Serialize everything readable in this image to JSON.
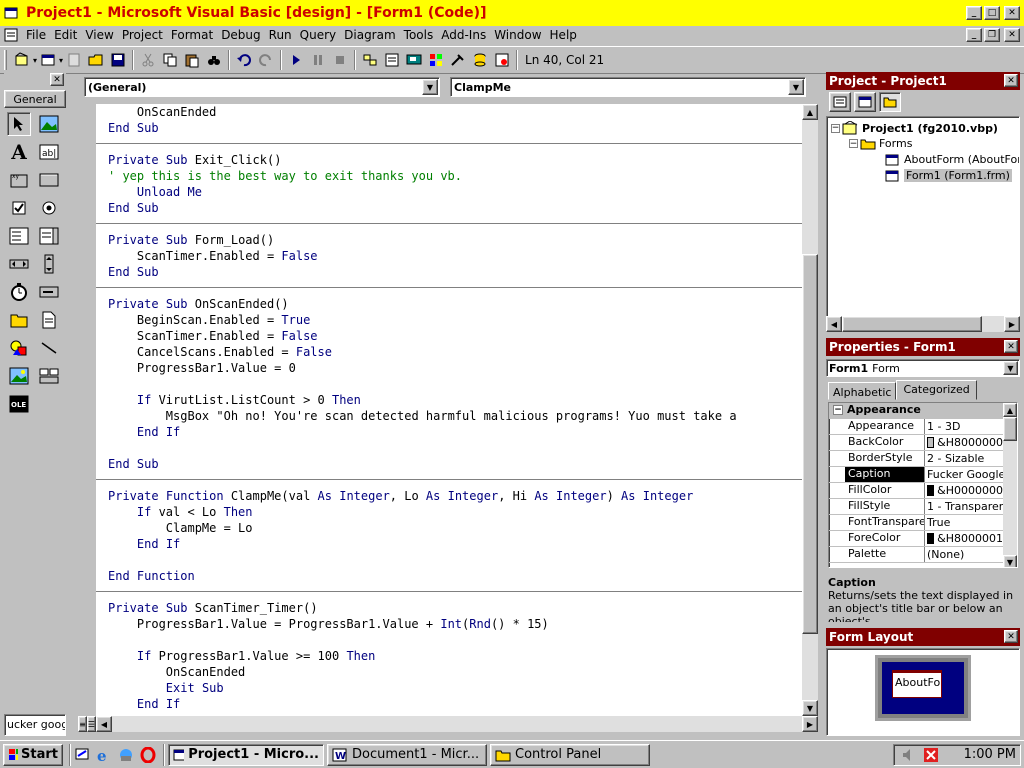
{
  "window": {
    "title": "Project1 - Microsoft Visual Basic [design] - [Form1 (Code)]"
  },
  "menu": [
    "File",
    "Edit",
    "View",
    "Project",
    "Format",
    "Debug",
    "Run",
    "Query",
    "Diagram",
    "Tools",
    "Add-Ins",
    "Window",
    "Help"
  ],
  "toolbar": {
    "position": "Ln 40, Col 21"
  },
  "toolbox": {
    "tab_label": "General",
    "status": "ucker googl"
  },
  "code": {
    "object_combo": "(General)",
    "procedure_combo": "ClampMe",
    "blocks": [
      [
        {
          "t": "    OnScanEnded"
        },
        {
          "t": "End Sub",
          "k": 1
        }
      ],
      [
        {
          "t": "Private Sub Exit_Click()",
          "k": 1
        },
        {
          "t": "' yep this is the best way to exit thanks you vb.",
          "c": 1
        },
        {
          "t": "    Unload Me"
        },
        {
          "t": "End Sub",
          "k": 1
        }
      ],
      [
        {
          "t": "Private Sub Form_Load()",
          "k": 1
        },
        {
          "t": "    ScanTimer.Enabled = False"
        },
        {
          "t": "End Sub",
          "k": 1
        }
      ],
      [
        {
          "t": "Private Sub OnScanEnded()",
          "k": 1
        },
        {
          "t": "    BeginScan.Enabled = True"
        },
        {
          "t": "    ScanTimer.Enabled = False"
        },
        {
          "t": "    CancelScans.Enabled = False"
        },
        {
          "t": "    ProgressBar1.Value = 0"
        },
        {
          "t": ""
        },
        {
          "t": "    If VirutList.ListCount > 0 Then"
        },
        {
          "t": "        MsgBox \"Oh no! You're scan detected harmful malicious programs! Yuo must take a"
        },
        {
          "t": "    End If"
        },
        {
          "t": ""
        },
        {
          "t": "End Sub",
          "k": 1
        }
      ],
      [
        {
          "t": "Private Function ClampMe(val As Integer, Lo As Integer, Hi As Integer) As Integer",
          "k": 1
        },
        {
          "t": "    If val < Lo Then"
        },
        {
          "t": "        ClampMe = Lo"
        },
        {
          "t": "    End If"
        },
        {
          "t": ""
        },
        {
          "t": "End Function",
          "k": 1
        }
      ],
      [
        {
          "t": "Private Sub ScanTimer_Timer()",
          "k": 1
        },
        {
          "t": "    ProgressBar1.Value = ProgressBar1.Value + Int(Rnd() * 15)"
        },
        {
          "t": ""
        },
        {
          "t": "    If ProgressBar1.Value >= 100 Then"
        },
        {
          "t": "        OnScanEnded"
        },
        {
          "t": "        Exit Sub"
        },
        {
          "t": "    End If"
        }
      ]
    ]
  },
  "project": {
    "title": "Project - Project1",
    "root": "Project1 (fg2010.vbp)",
    "folder": "Forms",
    "items": [
      "AboutForm (AboutForm",
      "Form1 (Form1.frm)"
    ]
  },
  "properties": {
    "title": "Properties - Form1",
    "object_name": "Form1",
    "object_type": "Form",
    "tabs": [
      "Alphabetic",
      "Categorized"
    ],
    "category": "Appearance",
    "rows": [
      {
        "name": "Appearance",
        "value": "1 - 3D"
      },
      {
        "name": "BackColor",
        "value": "&H8000000",
        "swatch": "#c0c0c0"
      },
      {
        "name": "BorderStyle",
        "value": "2 - Sizable"
      },
      {
        "name": "Caption",
        "value": "Fucker Google",
        "selected": true
      },
      {
        "name": "FillColor",
        "value": "&H0000000",
        "swatch": "#000000"
      },
      {
        "name": "FillStyle",
        "value": "1 - Transparen"
      },
      {
        "name": "FontTransparen",
        "value": "True"
      },
      {
        "name": "ForeColor",
        "value": "&H8000001",
        "swatch": "#000000"
      },
      {
        "name": "Palette",
        "value": "(None)"
      }
    ],
    "desc_title": "Caption",
    "desc_text": "Returns/sets the text displayed in an object's title bar or below an object's"
  },
  "form_layout": {
    "title": "Form Layout",
    "form_label": "AboutFo"
  },
  "taskbar": {
    "start": "Start",
    "tasks": [
      "Project1 - Micro...",
      "Document1 - Micr...",
      "Control Panel"
    ],
    "clock": "1:00 PM"
  },
  "colors": {
    "titlebar": "#ffff00",
    "titletext": "#cc0000",
    "panel_header": "#800000",
    "keyword": "#00007f",
    "comment": "#007f00"
  }
}
